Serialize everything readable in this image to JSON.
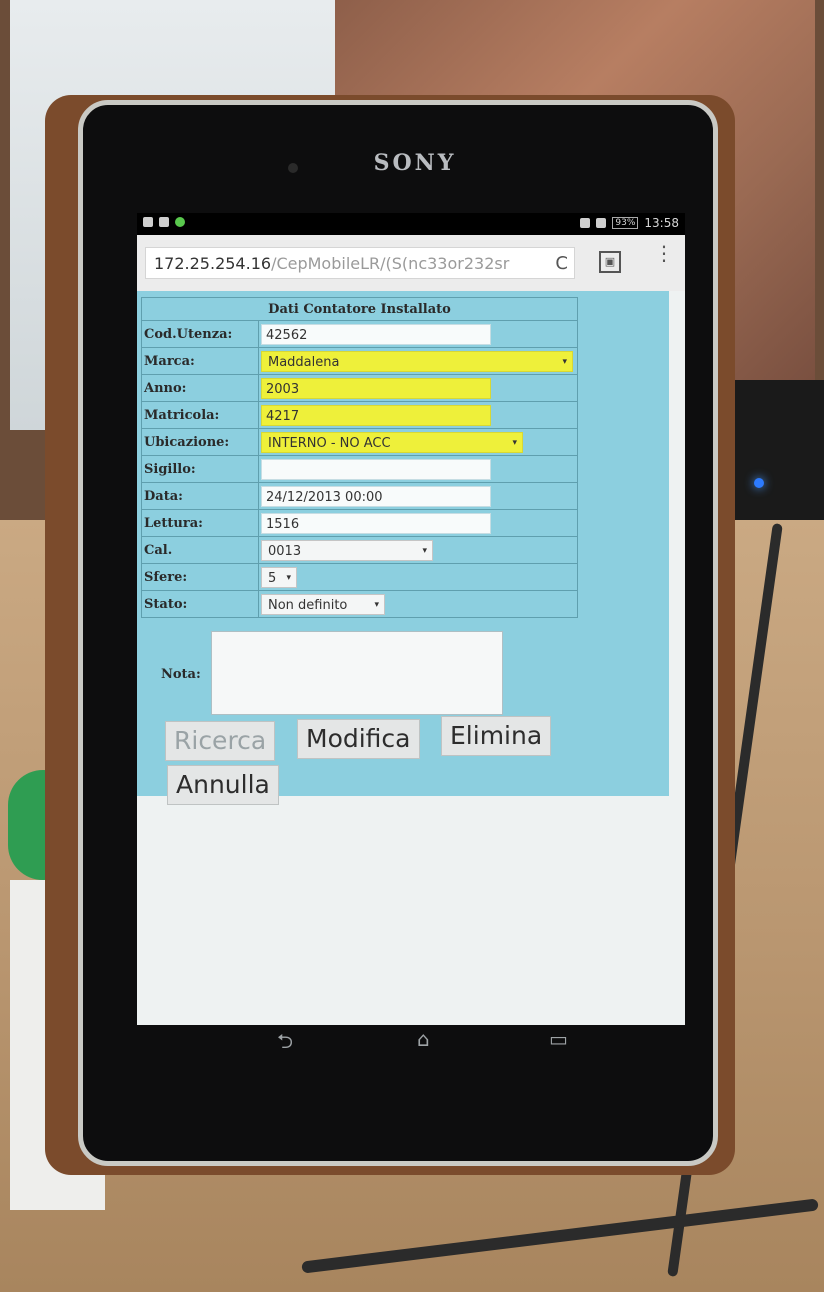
{
  "device": {
    "brand": "SONY"
  },
  "statusbar": {
    "time": "13:58",
    "battery": "93%"
  },
  "browser": {
    "url_host": "172.25.254.16",
    "url_path": "/CepMobileLR/(S(nc33or232sr",
    "reload_glyph": "C",
    "tabs_glyph": "▣",
    "menu_glyph": "⋮"
  },
  "form": {
    "title": "Dati Contatore Installato",
    "fields": {
      "cod_utenza": {
        "label": "Cod.Utenza:",
        "value": "42562"
      },
      "marca": {
        "label": "Marca:",
        "value": "Maddalena"
      },
      "anno": {
        "label": "Anno:",
        "value": "2003"
      },
      "matricola": {
        "label": "Matricola:",
        "value": "4217"
      },
      "ubicazione": {
        "label": "Ubicazione:",
        "value": "INTERNO - NO ACC"
      },
      "sigillo": {
        "label": "Sigillo:",
        "value": ""
      },
      "data": {
        "label": "Data:",
        "value": "24/12/2013 00:00"
      },
      "lettura": {
        "label": "Lettura:",
        "value": "1516"
      },
      "cal": {
        "label": "Cal.",
        "value": "0013"
      },
      "sfere": {
        "label": "Sfere:",
        "value": "5"
      },
      "stato": {
        "label": "Stato:",
        "value": "Non definito"
      }
    },
    "nota": {
      "label": "Nota:",
      "value": ""
    },
    "arrow_glyph": "▾"
  },
  "buttons": {
    "ricerca": "Ricerca",
    "modifica": "Modifica",
    "elimina": "Elimina",
    "annulla": "Annulla"
  },
  "android_nav": {
    "back": "⮌",
    "home": "⌂",
    "recents": "▭"
  },
  "colors": {
    "panel": "#8ccfdf",
    "highlight": "#eef03a"
  }
}
